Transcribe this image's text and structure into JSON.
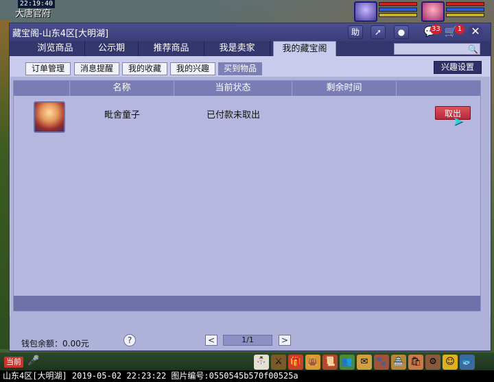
{
  "hud": {
    "time": "22:19:40",
    "location": "大唐官府"
  },
  "window": {
    "title": "藏宝阁-山东4区[大明湖]",
    "buttons": {
      "help": "助",
      "message_badge": "33",
      "cart_badge": "1"
    }
  },
  "tabs": [
    {
      "label": "浏览商品"
    },
    {
      "label": "公示期"
    },
    {
      "label": "推荐商品"
    },
    {
      "label": "我是卖家"
    },
    {
      "label": "我的藏宝阁",
      "active": true
    }
  ],
  "search": {
    "placeholder": ""
  },
  "subtabs": [
    {
      "label": "订单管理"
    },
    {
      "label": "消息提醒"
    },
    {
      "label": "我的收藏"
    },
    {
      "label": "我的兴趣"
    },
    {
      "label": "买到物品",
      "active": true
    }
  ],
  "interest_settings_label": "兴趣设置",
  "table": {
    "headers": [
      "",
      "名称",
      "当前状态",
      "剩余时间",
      ""
    ],
    "rows": [
      {
        "name": "毗舍童子",
        "status": "已付款未取出",
        "remaining": "",
        "action": "取出"
      }
    ]
  },
  "footer": {
    "wallet": "钱包余额：0.00元",
    "help": "?",
    "prev": "<",
    "page": "1/1",
    "next": ">"
  },
  "chat": {
    "channel": "当前"
  },
  "caption": "山东4区[大明湖] 2019-05-02 22:23:22 图片编号:0550545b570f00525a",
  "colors": {
    "accent": "#3b3d79",
    "panel": "#aeb1d8",
    "header": "#7a7db5",
    "withdraw": "#c9303f"
  }
}
